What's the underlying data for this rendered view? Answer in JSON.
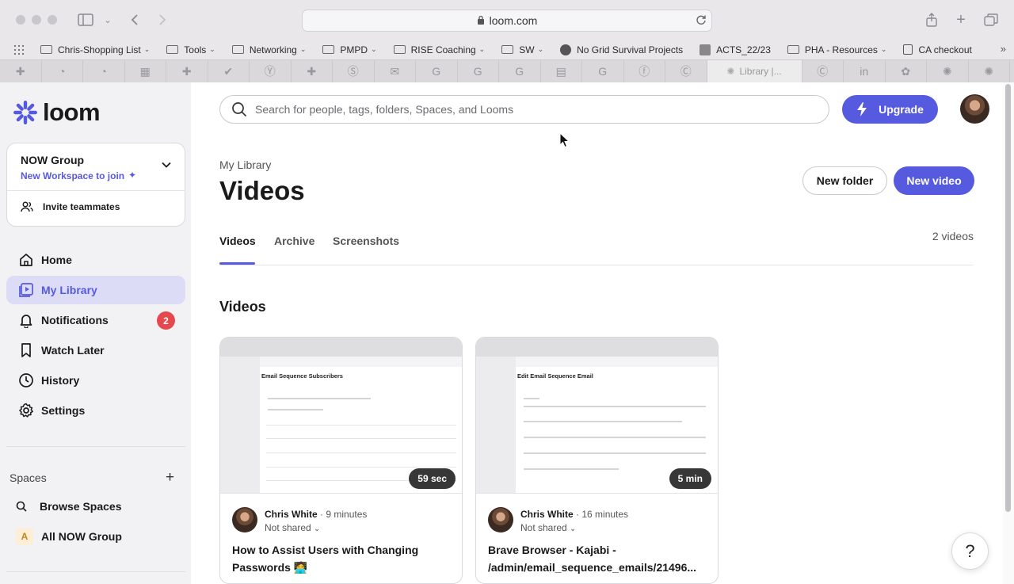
{
  "browser": {
    "url": "loom.com",
    "bookmarks": [
      {
        "label": "Chris-Shopping List",
        "kind": "folder",
        "caret": "⌄"
      },
      {
        "label": "Tools",
        "kind": "folder",
        "caret": "⌄"
      },
      {
        "label": "Networking",
        "kind": "folder",
        "caret": "⌄"
      },
      {
        "label": "PMPD",
        "kind": "folder",
        "caret": "⌄"
      },
      {
        "label": "RISE Coaching",
        "kind": "folder",
        "caret": "⌄"
      },
      {
        "label": "SW",
        "kind": "folder",
        "caret": "⌄"
      },
      {
        "label": "No Grid Survival Projects",
        "kind": "site"
      },
      {
        "label": "ACTS_22/23",
        "kind": "site"
      },
      {
        "label": "PHA - Resources",
        "kind": "folder",
        "caret": "⌄"
      },
      {
        "label": "CA checkout",
        "kind": "site"
      }
    ],
    "active_tab": "Library |..."
  },
  "sidebar": {
    "logo": "loom",
    "workspace": {
      "name": "NOW Group",
      "join_label": "New Workspace to join",
      "invite_label": "Invite teammates"
    },
    "nav": [
      {
        "label": "Home"
      },
      {
        "label": "My Library"
      },
      {
        "label": "Notifications",
        "badge": "2"
      },
      {
        "label": "Watch Later"
      },
      {
        "label": "History"
      },
      {
        "label": "Settings"
      }
    ],
    "spaces": {
      "heading": "Spaces",
      "add": "+",
      "browse": "Browse Spaces",
      "group": "All NOW Group",
      "group_initial": "A"
    }
  },
  "header": {
    "search_placeholder": "Search for people, tags, folders, Spaces, and Looms",
    "upgrade_label": "Upgrade"
  },
  "library": {
    "breadcrumb": "My Library",
    "title": "Videos",
    "new_folder": "New folder",
    "new_video": "New video",
    "tabs": [
      "Videos",
      "Archive",
      "Screenshots"
    ],
    "count": "2 videos",
    "section": "Videos"
  },
  "videos": [
    {
      "duration": "59 sec",
      "author": "Chris White",
      "age": "· 9 minutes",
      "shared": "Not shared",
      "title": "How to Assist Users with Changing Passwords 🧑‍💻",
      "thumb_title": "Email Sequence Subscribers"
    },
    {
      "duration": "5 min",
      "author": "Chris White",
      "age": "· 16 minutes",
      "shared": "Not shared",
      "title": "Brave Browser - Kajabi - /admin/email_sequence_emails/21496...",
      "thumb_title": "Edit Email Sequence Email"
    }
  ],
  "help_label": "?",
  "colors": {
    "brand": "#565ade",
    "badge": "#e5484d",
    "active_nav_bg": "#dcdcf6"
  }
}
